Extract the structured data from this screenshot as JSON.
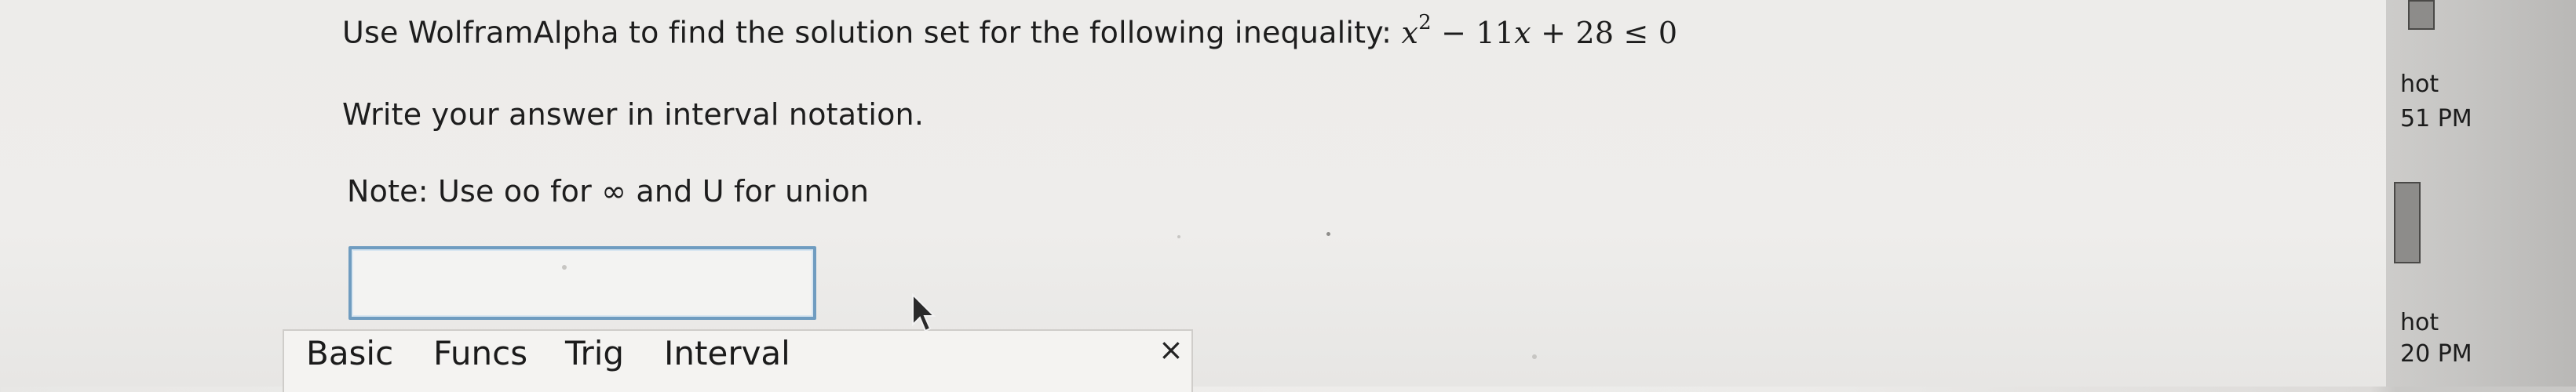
{
  "question": {
    "prompt": "Use WolframAlpha to find the solution set for the following inequality:",
    "inequality": {
      "x": "x",
      "exp": "2",
      "minus": "−",
      "coef": "11",
      "x2": "x",
      "plus": "+",
      "const": "28",
      "relation": "≤",
      "rhs": "0"
    },
    "instruction": "Write your answer in interval notation.",
    "note": "Note: Use oo for ∞ and U for union"
  },
  "answer": {
    "value": ""
  },
  "keyboard": {
    "tabs": [
      "Basic",
      "Funcs",
      "Trig",
      "Interval"
    ],
    "close": "×"
  },
  "side_panel": {
    "line1": "hot",
    "line2": "51 PM",
    "line3": "hot",
    "line4": "20 PM"
  }
}
